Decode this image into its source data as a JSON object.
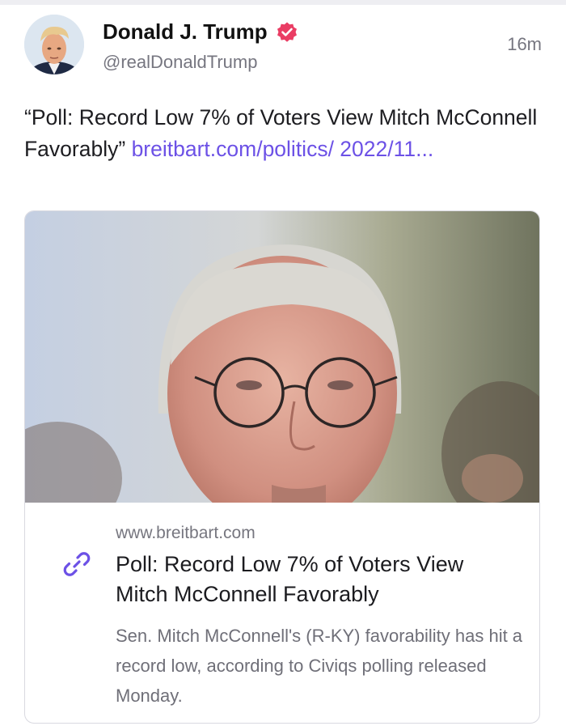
{
  "post": {
    "author": {
      "name": "Donald J. Trump",
      "handle": "@realDonaldTrump",
      "verified_icon": "verified-badge-icon",
      "verified_color": "#ea3d64"
    },
    "timestamp": "16m",
    "text": "“Poll: Record Low 7% of Voters View Mitch McConnell Favorably”",
    "link_text": "breitbart.com/politics/ 2022/11...",
    "link_color": "#6c51e6"
  },
  "card": {
    "icon": "link-icon",
    "domain": "www.breitbart.com",
    "title": "Poll: Record Low 7% of Voters View Mitch McConnell Favorably",
    "description": "Sen. Mitch McConnell's (R-KY) favorability has hit a record low, according to Civiqs polling released Monday."
  }
}
